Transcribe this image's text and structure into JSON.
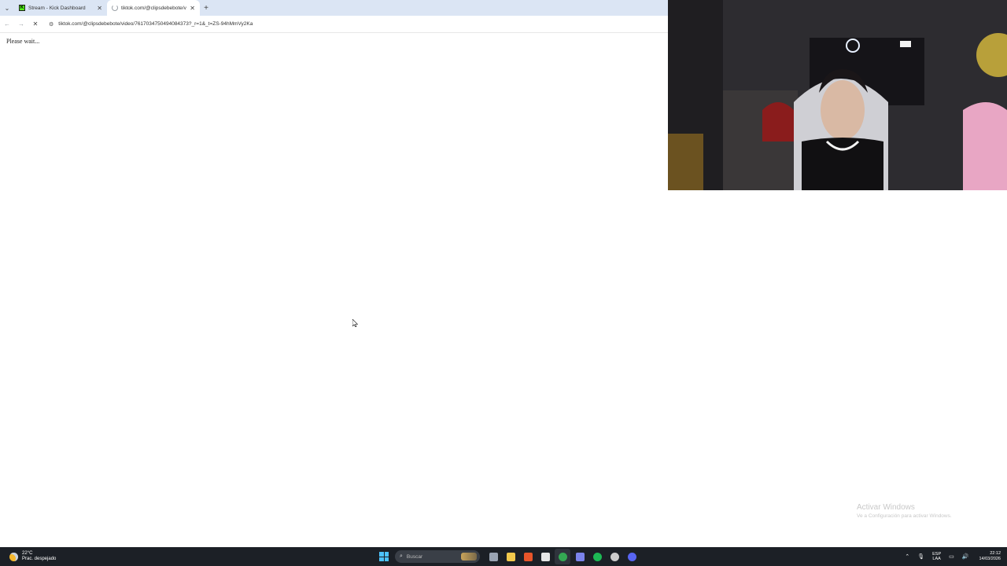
{
  "browser": {
    "tabs": [
      {
        "title": "Stream - Kick Dashboard",
        "favicon": "kick-icon",
        "active": false
      },
      {
        "title": "tiktok.com/@clipsdebebote/vi",
        "favicon": "loading-icon",
        "active": true
      }
    ],
    "url": "tiktok.com/@clipsdebebote/video/7617034750494084373?_r=1&_t=ZS-94hMmVy2Ka"
  },
  "page": {
    "message": "Please wait..."
  },
  "watermark": {
    "title": "Activar Windows",
    "subtitle": "Ve a Configuración para activar Windows."
  },
  "taskbar": {
    "weather_temp": "22°C",
    "weather_desc": "Prac. despejado",
    "search_placeholder": "Buscar",
    "lang_top": "ESP",
    "lang_bottom": "LAA",
    "time": "22:12",
    "date": "14/03/2026",
    "apps": [
      {
        "name": "task-view",
        "color": "#9aa4b3"
      },
      {
        "name": "file-explorer",
        "color": "#f2c94c"
      },
      {
        "name": "brave",
        "color": "#e8552a"
      },
      {
        "name": "microsoft-store",
        "color": "#e6e6e6"
      },
      {
        "name": "chrome",
        "color": "#34a853"
      },
      {
        "name": "teams",
        "color": "#7b83eb"
      },
      {
        "name": "spotify",
        "color": "#1db954"
      },
      {
        "name": "obs",
        "color": "#cccccc"
      },
      {
        "name": "discord",
        "color": "#5865f2"
      }
    ]
  },
  "colors": {
    "tabstrip": "#dbe5f4",
    "taskbar": "#1c2026",
    "accent": "#4cc2ff"
  }
}
